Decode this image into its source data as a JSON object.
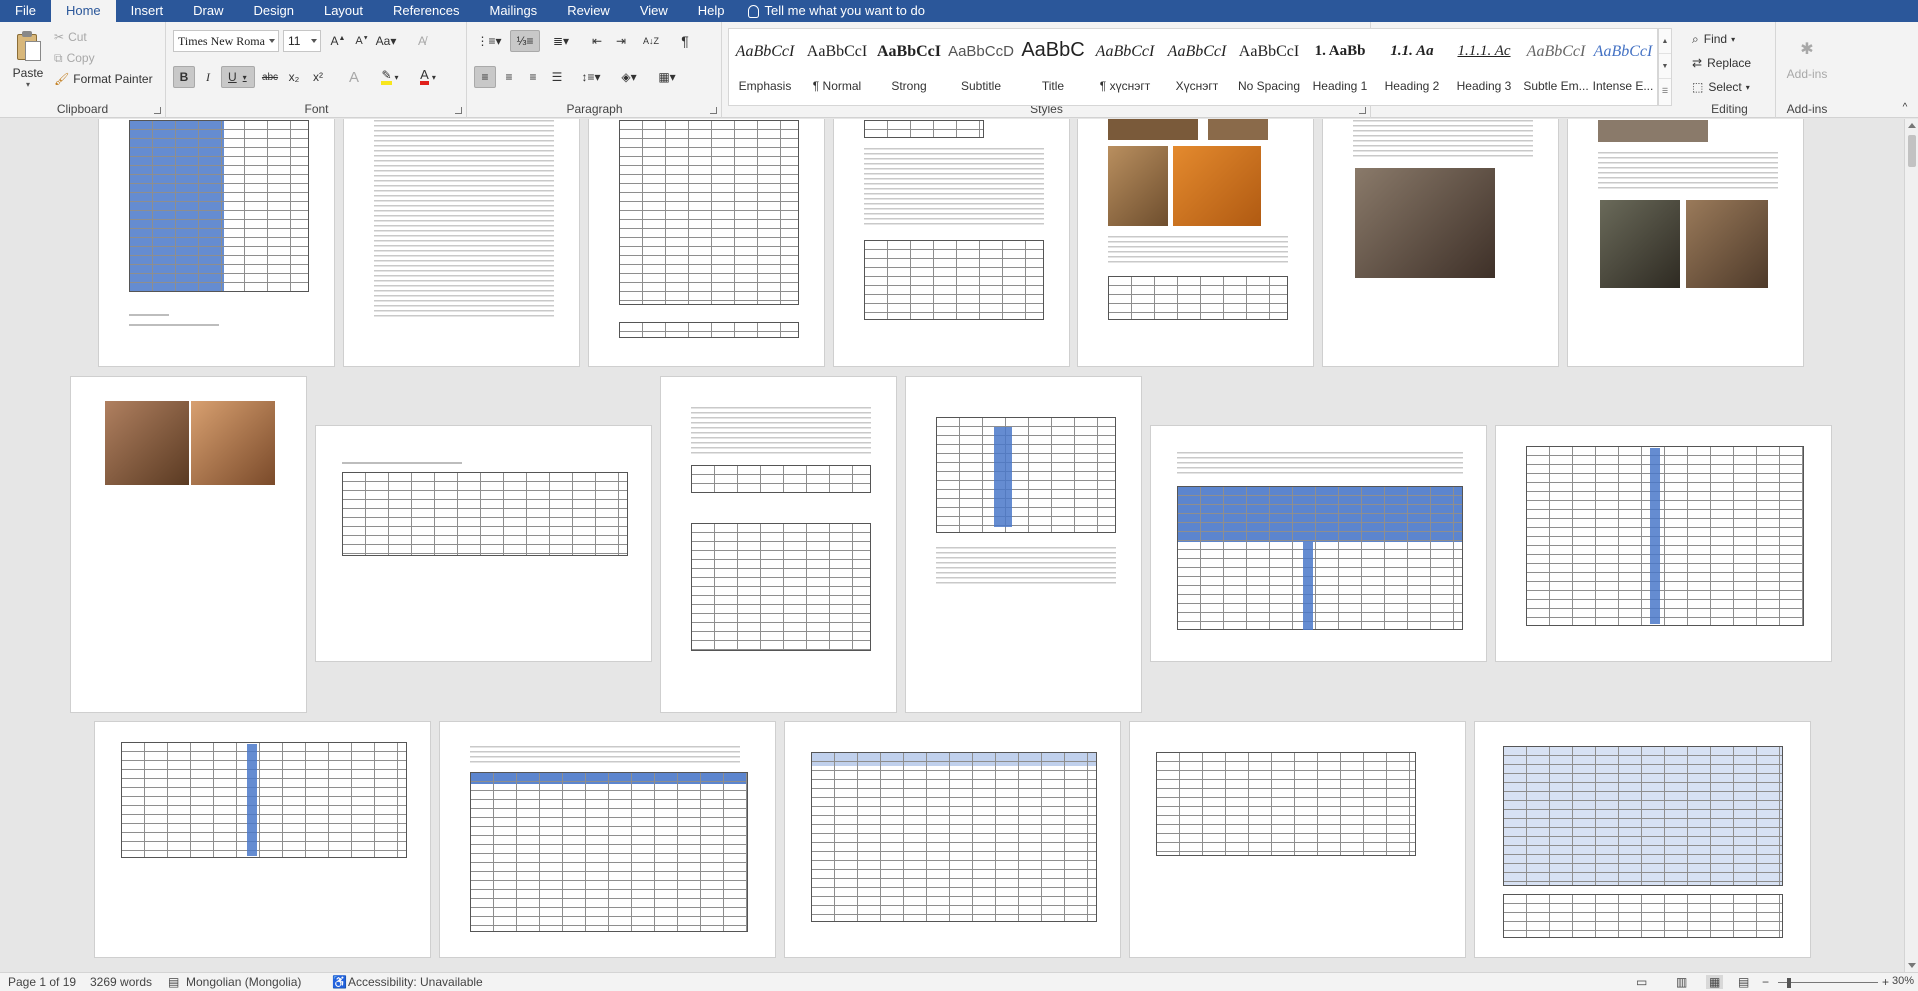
{
  "menu": {
    "tabs": [
      "File",
      "Home",
      "Insert",
      "Draw",
      "Design",
      "Layout",
      "References",
      "Mailings",
      "Review",
      "View",
      "Help"
    ],
    "active": "Home",
    "tell_me": "Tell me what you want to do"
  },
  "clipboard": {
    "paste": "Paste",
    "cut": "Cut",
    "copy": "Copy",
    "format_painter": "Format Painter",
    "label": "Clipboard"
  },
  "font": {
    "family": "Times New Roma",
    "size": "11",
    "label": "Font",
    "bold": "B",
    "italic": "I",
    "underline": "U",
    "strike": "abc",
    "subscript": "x₂",
    "superscript": "x²"
  },
  "paragraph": {
    "label": "Paragraph"
  },
  "styles": {
    "label": "Styles",
    "items": [
      {
        "preview": "AaBbCcI",
        "name": "Emphasis"
      },
      {
        "preview": "AaBbCcI",
        "name": "¶ Normal"
      },
      {
        "preview": "AaBbCcI",
        "name": "Strong"
      },
      {
        "preview": "AaBbCcD",
        "name": "Subtitle"
      },
      {
        "preview": "AaBbC",
        "name": "Title"
      },
      {
        "preview": "AaBbCcI",
        "name": "¶ хүснэгт"
      },
      {
        "preview": "AaBbCcI",
        "name": "Хүснэгт"
      },
      {
        "preview": "AaBbCcI",
        "name": "No Spacing"
      },
      {
        "preview": "1. AaBb",
        "name": "Heading 1"
      },
      {
        "preview": "1.1. Aa",
        "name": "Heading 2"
      },
      {
        "preview": "1.1.1. Ac",
        "name": "Heading 3"
      },
      {
        "preview": "AaBbCcI",
        "name": "Subtle Em..."
      },
      {
        "preview": "AaBbCcI",
        "name": "Intense E..."
      }
    ]
  },
  "editing": {
    "find": "Find",
    "replace": "Replace",
    "select": "Select",
    "label": "Editing"
  },
  "addins": {
    "button": "Add-ins",
    "label": "Add-ins"
  },
  "status": {
    "page": "Page 1 of 19",
    "words": "3269 words",
    "language": "Mongolian (Mongolia)",
    "accessibility": "Accessibility: Unavailable",
    "zoom": "30%",
    "zoom_fraction": 0.3
  }
}
